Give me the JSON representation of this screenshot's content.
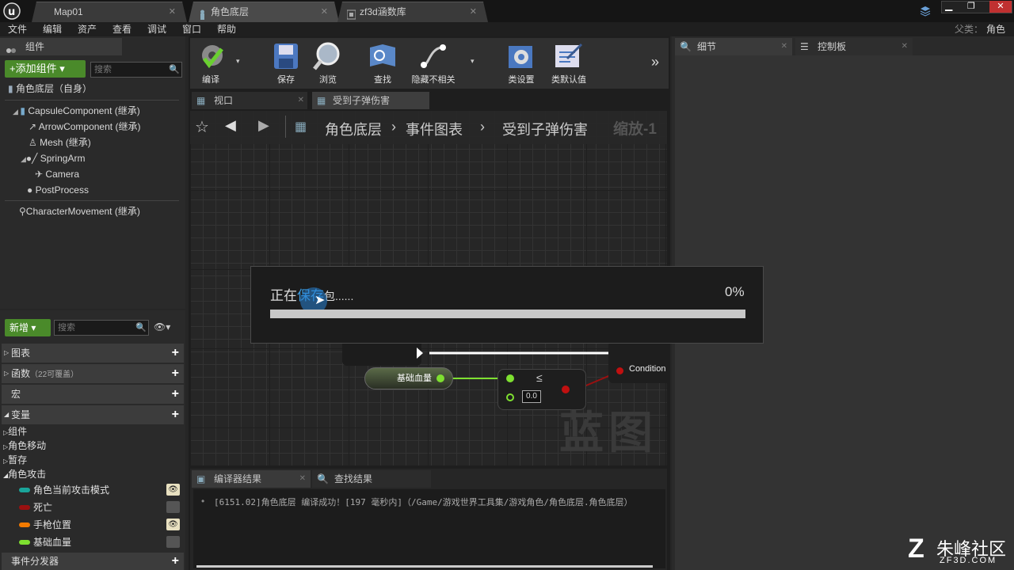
{
  "tabs": [
    {
      "label": "Map01"
    },
    {
      "label": "角色底层"
    },
    {
      "label": "zf3d涵数库"
    }
  ],
  "menu": [
    "文件",
    "编辑",
    "资产",
    "查看",
    "调试",
    "窗口",
    "帮助"
  ],
  "parent": {
    "label": "父类：",
    "value": "角色"
  },
  "components_panel": {
    "title": "组件",
    "add_label": "+添加组件",
    "search_placeholder": "搜索",
    "self_label": "角色底层（自身）",
    "tree": [
      "CapsuleComponent (继承)",
      "ArrowComponent (继承)",
      "Mesh (继承)",
      "SpringArm",
      "Camera",
      "PostProcess",
      "CharacterMovement (继承)"
    ]
  },
  "toolbar": [
    "编译",
    "保存",
    "浏览",
    "查找",
    "隐藏不相关",
    "类设置",
    "类默认值"
  ],
  "graph_tabs": [
    "视口",
    "受到子弹伤害"
  ],
  "breadcrumb": {
    "root": "角色底层",
    "mid": "事件图表",
    "leaf": "受到子弹伤害",
    "zoom": "缩放-1"
  },
  "mybp": {
    "new_label": "新增",
    "search_placeholder": "搜索",
    "sections": [
      {
        "label": "图表"
      },
      {
        "label": "函数",
        "extra": "（22可覆盖）"
      },
      {
        "label": "宏"
      },
      {
        "label": "变量"
      }
    ],
    "categories": [
      "组件",
      "角色移动",
      "暂存",
      "角色攻击"
    ],
    "variables": [
      {
        "name": "角色当前攻击模式",
        "color": "#1aa59a",
        "eye": true
      },
      {
        "name": "死亡",
        "color": "#9a1010",
        "eye": false
      },
      {
        "name": "手枪位置",
        "color": "#f27a00",
        "eye": true
      },
      {
        "name": "基础血量",
        "color": "#7ee030",
        "eye": false
      }
    ],
    "dispatchers": "事件分发器"
  },
  "nodes": {
    "var_node": "基础血量",
    "cond_pin": "Condition",
    "compare_default": "0.0",
    "watermark": "蓝图"
  },
  "dialog": {
    "text_a": "正在",
    "text_b": "保存",
    "text_c": "包......",
    "percent": "0%",
    "progress": 0
  },
  "details": {
    "title": "细节",
    "palette": "控制板"
  },
  "bottom": {
    "tabs": [
      "编译器结果",
      "查找结果"
    ],
    "log": "[6151.02]角色底层 编译成功！[197 毫秒内]（/Game/游戏世界工具集/游戏角色/角色底层.角色底层）"
  },
  "logo": {
    "cn": "朱峰社区",
    "en": "ZF3D.COM"
  }
}
